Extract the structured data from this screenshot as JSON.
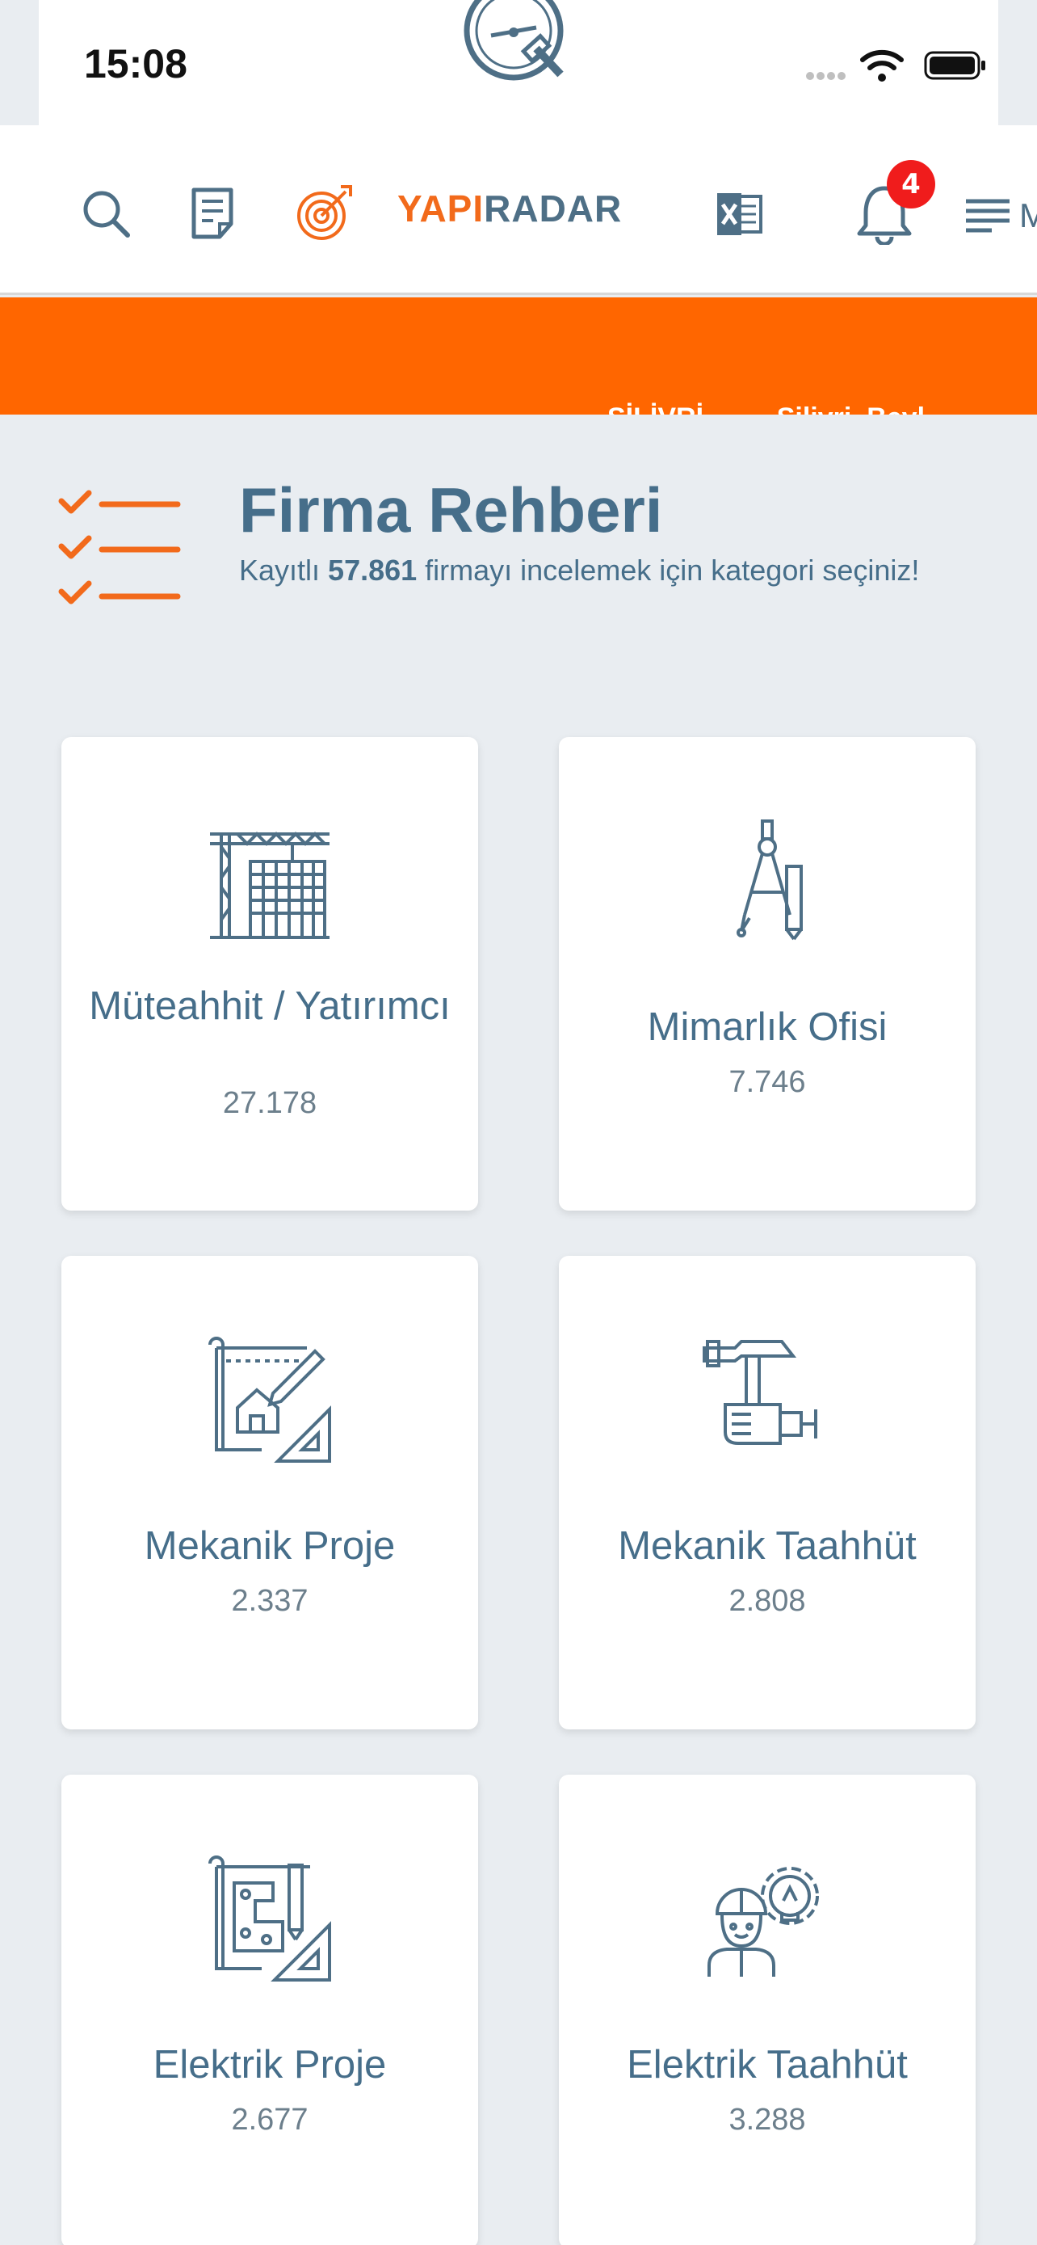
{
  "status_bar": {
    "time": "15:08"
  },
  "navbar": {
    "brand_part1": "YAPI",
    "brand_part2": "RADAR",
    "notification_count": "4",
    "menu_label_partial": "M",
    "icons": [
      "search-icon",
      "document-icon",
      "target-icon",
      "excel-icon",
      "bell-icon",
      "menu-icon"
    ]
  },
  "ticker": {
    "text": "SİLİVRİ ... → Silivri, Beyl"
  },
  "header": {
    "title": "Firma Rehberi",
    "subtitle_prefix": "Kayıtlı ",
    "subtitle_count": "57.861",
    "subtitle_suffix": " firmayı incelemek için kategori seçiniz!"
  },
  "categories": [
    {
      "name": "Müteahhit / Yatırımcı",
      "count": "27.178",
      "icon": "crane-building-icon"
    },
    {
      "name": "Mimarlık Ofisi",
      "count": "7.746",
      "icon": "compass-icon"
    },
    {
      "name": "Mekanik Proje",
      "count": "2.337",
      "icon": "blueprint-house-icon"
    },
    {
      "name": "Mekanik Taahhüt",
      "count": "2.808",
      "icon": "hammer-hand-icon"
    },
    {
      "name": "Elektrik Proje",
      "count": "2.677",
      "icon": "blueprint-plan-icon"
    },
    {
      "name": "Elektrik Taahhüt",
      "count": "3.288",
      "icon": "engineer-bulb-icon"
    }
  ],
  "colors": {
    "accent_orange": "#ff6600",
    "brand_blue": "#4e6f86",
    "badge_red": "#f01c1c",
    "background": "#e9edf1"
  }
}
